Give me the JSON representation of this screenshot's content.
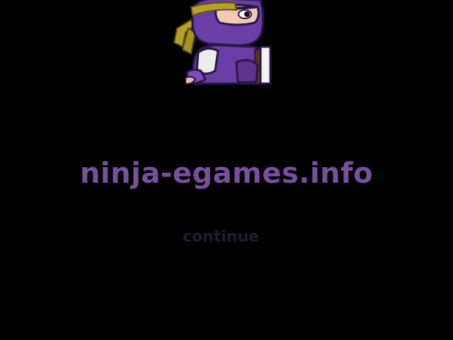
{
  "splash": {
    "site_name": "ninja-egames.info",
    "continue_label": "continue"
  },
  "mascot": {
    "icon": "ninja-mascot-icon"
  },
  "colors": {
    "background": "#000000",
    "title": "#7a4fa0",
    "continue": "#241833",
    "ninja_purple": "#6a3ea6",
    "headband": "#b7a027"
  }
}
